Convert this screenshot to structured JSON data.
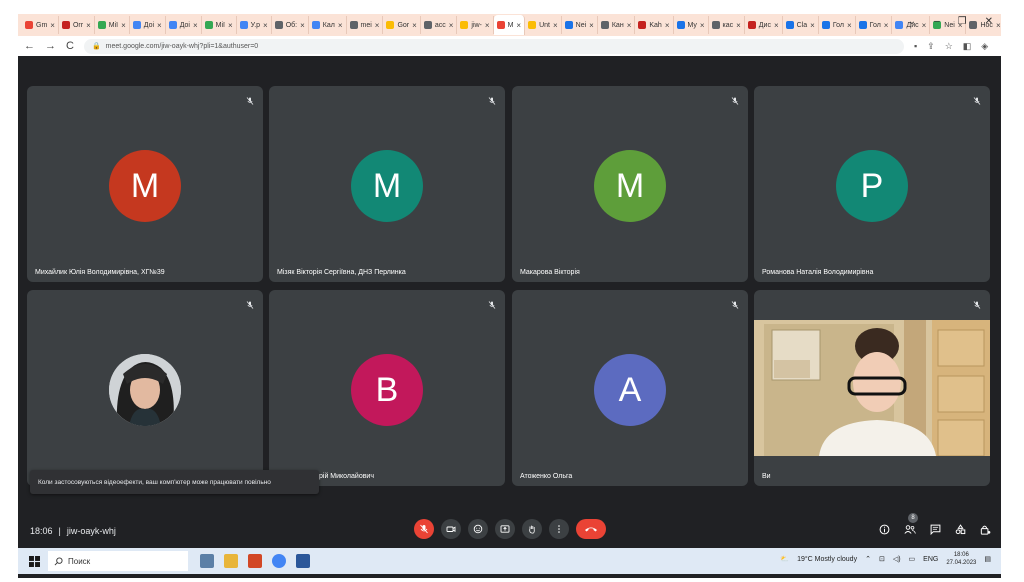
{
  "browser": {
    "tabs": [
      {
        "label": "Gm",
        "color": "#ea4335"
      },
      {
        "label": "Orr",
        "color": "#c5221f"
      },
      {
        "label": "Мії",
        "color": "#34a853"
      },
      {
        "label": "Доі",
        "color": "#4285f4"
      },
      {
        "label": "Доі",
        "color": "#4285f4"
      },
      {
        "label": "Мії",
        "color": "#34a853"
      },
      {
        "label": "У.р",
        "color": "#4285f4"
      },
      {
        "label": "Об:",
        "color": "#5f6368"
      },
      {
        "label": "Кал",
        "color": "#4285f4"
      },
      {
        "label": "mei",
        "color": "#5f6368"
      },
      {
        "label": "Gor",
        "color": "#fbbc04"
      },
      {
        "label": "acc",
        "color": "#5f6368"
      },
      {
        "label": "jiw-",
        "color": "#fbbc04"
      },
      {
        "label": "M",
        "color": "#ea4335",
        "active": true
      },
      {
        "label": "Unt",
        "color": "#fbbc04"
      },
      {
        "label": "Nei",
        "color": "#1a73e8"
      },
      {
        "label": "Кан",
        "color": "#5f6368"
      },
      {
        "label": "Kah",
        "color": "#c5221f"
      },
      {
        "label": "My",
        "color": "#1a73e8"
      },
      {
        "label": "кас",
        "color": "#5f6368"
      },
      {
        "label": "Дис",
        "color": "#c5221f"
      },
      {
        "label": "Cla",
        "color": "#1a73e8"
      },
      {
        "label": "Гол",
        "color": "#1a73e8"
      },
      {
        "label": "Гол",
        "color": "#1a73e8"
      },
      {
        "label": "Дис",
        "color": "#4285f4"
      },
      {
        "label": "Nei",
        "color": "#34a853"
      },
      {
        "label": "Нос",
        "color": "#5f6368"
      }
    ],
    "url": "meet.google.com/jiw-oayk-whj?pli=1&authuser=0"
  },
  "meeting": {
    "participants": [
      {
        "name": "Михайлик Юлія Володимирівна, ХГ№39",
        "initial": "M",
        "color": "#c5381f"
      },
      {
        "name": "Мізяк Вікторія Сергіївна, ДНЗ Перлинка",
        "initial": "M",
        "color": "#128875"
      },
      {
        "name": "Макарова Вікторія",
        "initial": "M",
        "color": "#5e9e3a"
      },
      {
        "name": "Романова Наталія Володимирівна",
        "initial": "P",
        "color": "#128875"
      },
      {
        "name": "",
        "initial": "",
        "color": "#c9cdd1"
      },
      {
        "name": "рій Миколайович",
        "initial": "B",
        "color": "#c2185b"
      },
      {
        "name": "Атоженко Ольга",
        "initial": "A",
        "color": "#5c6bc0"
      },
      {
        "name": "Ви",
        "initial": "",
        "color": "#d9c7a6"
      }
    ],
    "toast": "Коли застосовуються відеоефекти, ваш комп'ютер може працювати повільно",
    "time": "18:06",
    "code": "jiw-oayk-whj",
    "people_count": "8"
  },
  "taskbar": {
    "search_placeholder": "Поиск",
    "weather": "19°C  Mostly cloudy",
    "lang": "ENG",
    "time": "18:06",
    "date": "27.04.2023"
  }
}
